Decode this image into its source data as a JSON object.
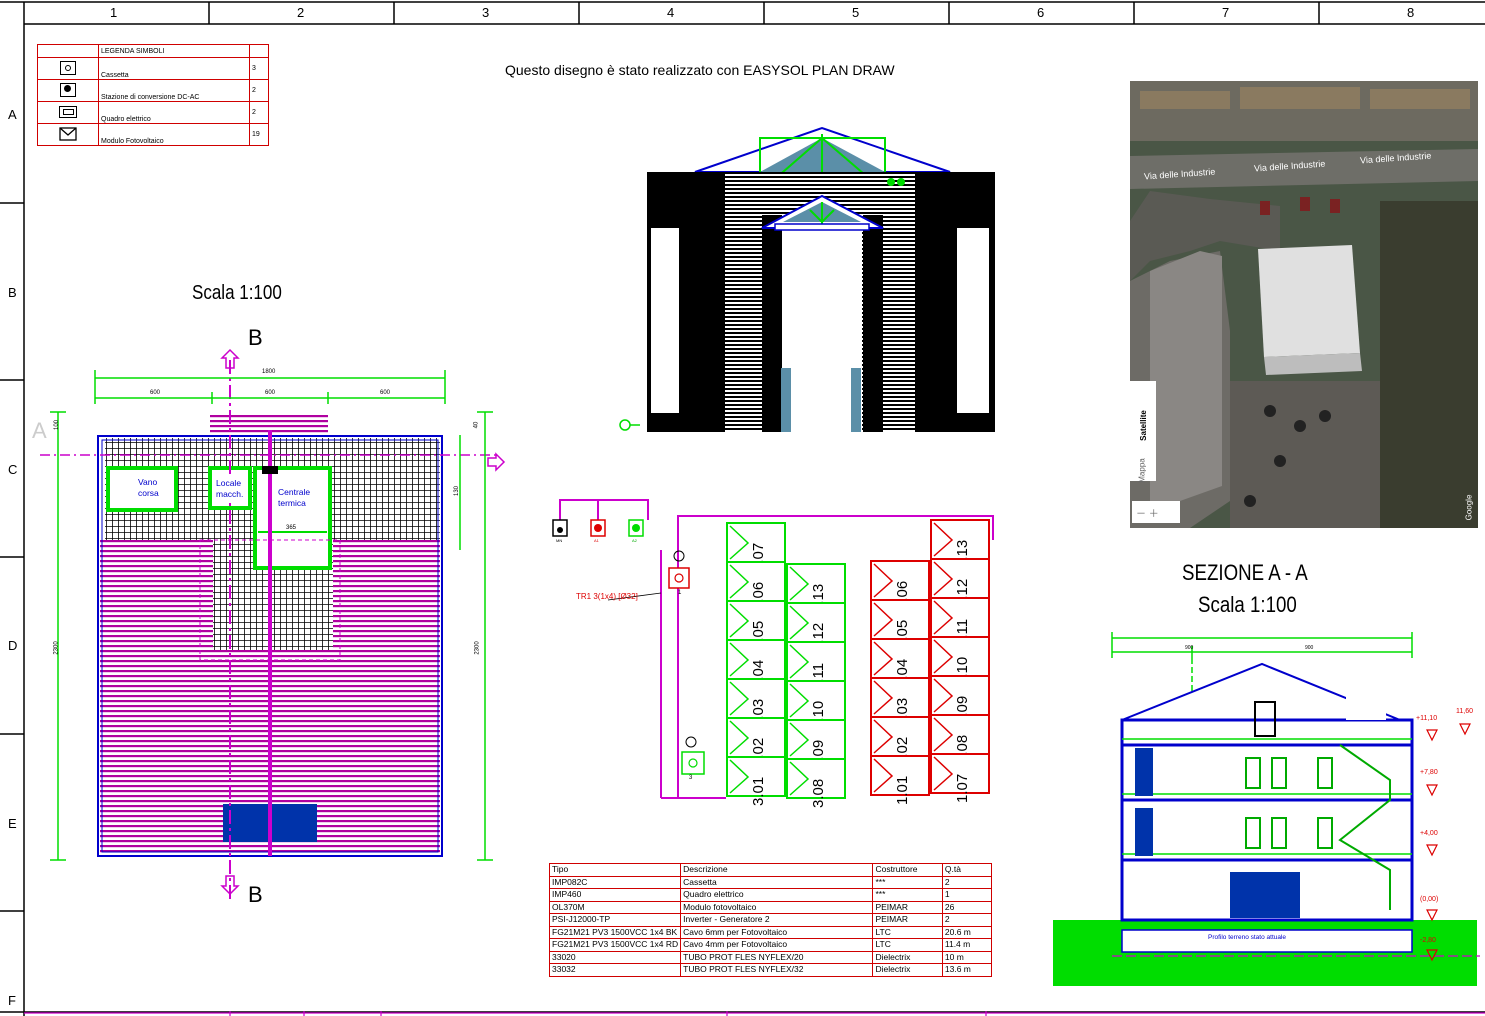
{
  "frame": {
    "columns": [
      "1",
      "2",
      "3",
      "4",
      "5",
      "6",
      "7",
      "8"
    ],
    "rows": [
      "A",
      "B",
      "C",
      "D",
      "E",
      "F"
    ]
  },
  "legend": {
    "title": "LEGENDA SIMBOLI",
    "items": [
      {
        "label": "Cassetta",
        "qty": "3"
      },
      {
        "label": "Stazione di conversione DC-AC",
        "qty": "2"
      },
      {
        "label": "Quadro elettrico",
        "qty": "2"
      },
      {
        "label": "Modulo Fotovoltaico",
        "qty": "19"
      }
    ]
  },
  "header_text": "Questo disegno è stato realizzato con EASYSOL PLAN DRAW",
  "plan": {
    "scale": "Scala 1:100",
    "section_letter_b": "B",
    "section_letter_a": "A",
    "rooms": {
      "vano_corsa": "Vano corsa",
      "locale_macch": "Locale macch.",
      "centrale_termica": "Centrale termica"
    },
    "dims": {
      "total_width": "1800",
      "segment_1": "600",
      "segment_2": "600",
      "segment_3": "600",
      "height_left": "2300",
      "height_right": "2300",
      "inner_365": "365",
      "small_100": "100",
      "small_40": "40",
      "small_130": "130"
    }
  },
  "schematic": {
    "cable_label": "TR1 3(1x4) [Ø32]",
    "inverter_labels": [
      "MN",
      "A1",
      "A2"
    ],
    "box_labels": [
      "1",
      "3"
    ],
    "string_green_col1": [
      "3.07",
      "3.06",
      "3.05",
      "3.04",
      "3.03",
      "3.02",
      "3.01"
    ],
    "string_green_col2": [
      "3.13",
      "3.12",
      "3.11",
      "3.10",
      "3.09",
      "3.08"
    ],
    "string_red_col1": [
      "1.06",
      "1.05",
      "1.04",
      "1.03",
      "1.02",
      "1.01"
    ],
    "string_red_col2": [
      "1.13",
      "1.12",
      "1.11",
      "1.10",
      "1.09",
      "1.08",
      "1.07"
    ]
  },
  "bom": {
    "headers": [
      "Tipo",
      "Descrizione",
      "Costruttore",
      "Q.tà"
    ],
    "rows": [
      [
        "IMP082C",
        "Cassetta",
        "***",
        "2"
      ],
      [
        "IMP460",
        "Quadro elettrico",
        "***",
        "1"
      ],
      [
        "OL370M",
        "Modulo fotovoltaico",
        "PEIMAR",
        "26"
      ],
      [
        "PSI-J12000-TP",
        "Inverter - Generatore 2",
        "PEIMAR",
        "2"
      ],
      [
        "FG21M21 PV3 1500VCC 1x4 BK",
        "Cavo 6mm per Fotovoltaico",
        "LTC",
        "20.6 m"
      ],
      [
        "FG21M21 PV3 1500VCC 1x4 RD",
        "Cavo 4mm per Fotovoltaico",
        "LTC",
        "11.4 m"
      ],
      [
        "33020",
        "TUBO PROT FLES NYFLEX/20",
        "Dielectrix",
        "10 m"
      ],
      [
        "33032",
        "TUBO PROT FLES NYFLEX/32",
        "Dielectrix",
        "13.6 m"
      ]
    ]
  },
  "map": {
    "streets": [
      "Via delle Industrie",
      "Via delle Industrie",
      "Via delle Industrie"
    ],
    "tabs": [
      "Mappa",
      "Satellite"
    ],
    "google": "Google"
  },
  "section": {
    "title": "SEZIONE A - A",
    "scale": "Scala 1:100",
    "levels": [
      "+11,10",
      "11,60",
      "+7,80",
      "+4,00",
      "(0,00)",
      "-2,80"
    ],
    "ground_label": "Profilo terreno stato attuale",
    "dims_top": [
      "900",
      "900"
    ]
  },
  "colors": {
    "frame_red": "#d00000",
    "magenta": "#cc00cc",
    "green": "#00dd00",
    "blue": "#0000cc",
    "red": "#dd0000"
  }
}
